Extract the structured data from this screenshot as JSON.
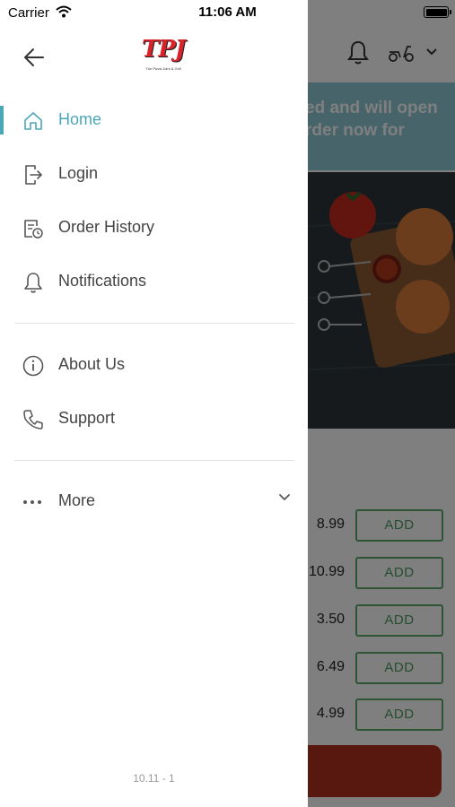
{
  "status_bar": {
    "carrier": "Carrier",
    "time": "11:06 AM"
  },
  "background": {
    "banner_line1": "ed and will open",
    "banner_line2": "rder now for",
    "prices": [
      "8.99",
      "10.99",
      "3.50",
      "6.49",
      "4.99"
    ],
    "add_label": "ADD"
  },
  "drawer": {
    "back_icon": "arrow-left-icon",
    "logo_text": "TPJ",
    "logo_subtitle": "The Pizza Joint & Grill",
    "items": [
      {
        "label": "Home",
        "icon": "home-icon",
        "active": true
      },
      {
        "label": "Login",
        "icon": "login-icon",
        "active": false
      },
      {
        "label": "Order History",
        "icon": "order-history-icon",
        "active": false
      },
      {
        "label": "Notifications",
        "icon": "bell-icon",
        "active": false
      },
      {
        "label": "About Us",
        "icon": "info-icon",
        "active": false
      },
      {
        "label": "Support",
        "icon": "phone-icon",
        "active": false
      },
      {
        "label": "More",
        "icon": "more-dots-icon",
        "active": false
      }
    ],
    "version": "10.11 - 1"
  },
  "colors": {
    "accent": "#4aa7b8",
    "add_button": "#5aa86a",
    "banner": "#8dc9d4",
    "checkout": "#b03020"
  }
}
